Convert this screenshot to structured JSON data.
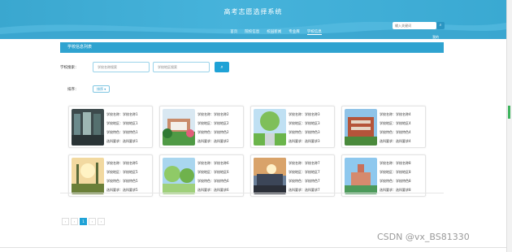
{
  "header": {
    "site_title": "高考志愿选择系统",
    "nav": [
      "首页",
      "院校信息",
      "校园新闻",
      "专业库",
      "学校信息"
    ],
    "active_nav": 4,
    "search_placeholder": "输入关键词",
    "search_icon": "search-icon",
    "login_label": "我的"
  },
  "panel": {
    "title": "学校信息列表",
    "search_label": "学校搜索：",
    "input1_placeholder": "学校名称搜索",
    "input2_placeholder": "学校地区搜索",
    "search_button_icon": "search-icon",
    "sort_label": "排序：",
    "sort_button": "排序"
  },
  "schools": [
    {
      "name": "学校名称：学校名称1",
      "area": "学校地区：学校地区1",
      "feature": "学校特色：学校特色1",
      "req": "选科要求：选科要求1"
    },
    {
      "name": "学校名称：学校名称2",
      "area": "学校地区：学校地区2",
      "feature": "学校特色：学校特色2",
      "req": "选科要求：选科要求2"
    },
    {
      "name": "学校名称：学校名称3",
      "area": "学校地区：学校地区3",
      "feature": "学校特色：学校特色3",
      "req": "选科要求：选科要求3"
    },
    {
      "name": "学校名称：学校名称4",
      "area": "学校地区：学校地区4",
      "feature": "学校特色：学校特色4",
      "req": "选科要求：选科要求4"
    },
    {
      "name": "学校名称：学校名称5",
      "area": "学校地区：学校地区5",
      "feature": "学校特色：学校特色5",
      "req": "选科要求：选科要求5"
    },
    {
      "name": "学校名称：学校名称6",
      "area": "学校地区：学校地区6",
      "feature": "学校特色：学校特色6",
      "req": "选科要求：选科要求6"
    },
    {
      "name": "学校名称：学校名称7",
      "area": "学校地区：学校地区7",
      "feature": "学校特色：学校特色7",
      "req": "选科要求：选科要求7"
    },
    {
      "name": "学校名称：学校名称8",
      "area": "学校地区：学校地区8",
      "feature": "学校特色：学校特色8",
      "req": "选科要求：选科要求8"
    }
  ],
  "pager": {
    "prev": "‹",
    "prev2": "‹",
    "current": "1",
    "next": "›",
    "next2": "›"
  },
  "watermark": "CSDN @vx_BS81330",
  "colors": {
    "brand": "#2fa3d0",
    "accent": "#1fa2d6"
  }
}
